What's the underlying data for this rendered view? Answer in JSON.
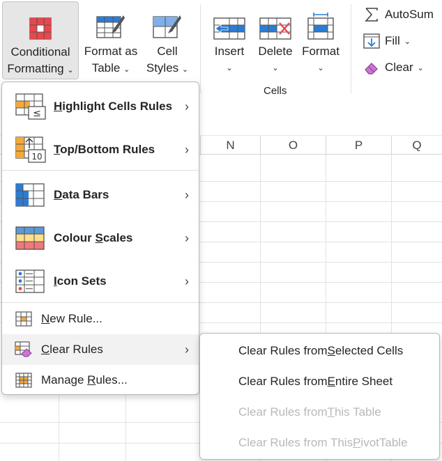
{
  "ribbon": {
    "conditional_formatting": {
      "line1": "Conditional",
      "line2": "Formatting"
    },
    "format_as_table": {
      "line1": "Format as",
      "line2": "Table"
    },
    "cell_styles": {
      "line1": "Cell",
      "line2": "Styles"
    },
    "insert": "Insert",
    "delete": "Delete",
    "format": "Format",
    "cells_group": "Cells",
    "autosum": "AutoSum",
    "fill": "Fill",
    "clear": "Clear",
    "chevron": "⌄"
  },
  "sheet": {
    "columns": [
      "N",
      "O",
      "P",
      "Q"
    ]
  },
  "menu": {
    "highlight": {
      "pre": "",
      "key": "H",
      "post": "ighlight Cells Rules"
    },
    "topbottom": {
      "pre": "",
      "key": "T",
      "post": "op/Bottom Rules"
    },
    "databars": {
      "pre": "",
      "key": "D",
      "post": "ata Bars"
    },
    "colourscales": {
      "pre": "Colour ",
      "key": "S",
      "post": "cales"
    },
    "iconsets": {
      "pre": "",
      "key": "I",
      "post": "con Sets"
    },
    "newrule": {
      "pre": "",
      "key": "N",
      "post": "ew Rule..."
    },
    "clearrules": {
      "pre": "",
      "key": "C",
      "post": "lear Rules"
    },
    "managerules": {
      "pre": "Manage ",
      "key": "R",
      "post": "ules..."
    },
    "arrow": "›",
    "topbottom_badge": "10",
    "highlight_badge": "≤"
  },
  "submenu": {
    "selected": {
      "pre": "Clear Rules from ",
      "key": "S",
      "post": "elected Cells"
    },
    "entire": {
      "pre": "Clear Rules from ",
      "key": "E",
      "post": "ntire Sheet"
    },
    "table": {
      "pre": "Clear Rules from ",
      "key": "T",
      "post": "his Table"
    },
    "pivot": {
      "pre": "Clear Rules from This ",
      "key": "P",
      "post": "ivotTable"
    }
  },
  "colors": {
    "accent_blue": "#2b7cd3",
    "red": "#e8474d",
    "orange": "#f3a93b",
    "highlight_bg": "#f2f2f2"
  }
}
